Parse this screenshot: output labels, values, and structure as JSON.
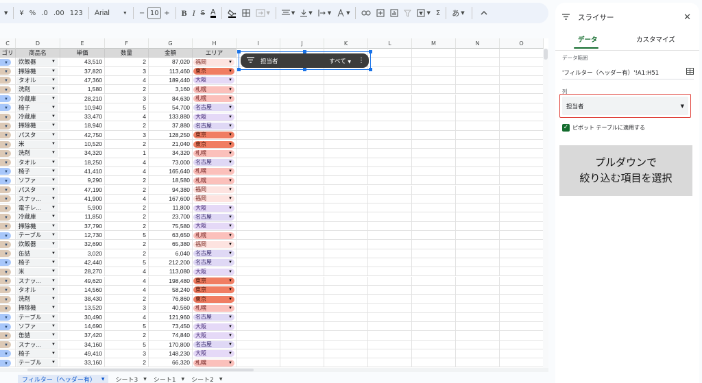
{
  "toolbar": {
    "font": "Arial",
    "font_size": "10",
    "percent": "%",
    "dec_dec": ".0",
    "dec_inc": ".00",
    "num_format": "123",
    "currency": "¥",
    "minus": "−",
    "plus": "+",
    "bold": "B",
    "italic": "I",
    "strike": "S",
    "text_color": "A",
    "sum": "Σ",
    "input_tools": "あ"
  },
  "columns": [
    "C",
    "D",
    "E",
    "F",
    "G",
    "H",
    "I",
    "J",
    "K",
    "L",
    "M",
    "N",
    "O"
  ],
  "header_row": {
    "c": "ゴリ",
    "d": "商品名",
    "e": "単価",
    "f": "数量",
    "g": "金額",
    "h": "エリア"
  },
  "rows": [
    {
      "c": "b",
      "d": "炊飯器",
      "e": "43,510",
      "f": "2",
      "g": "87,020",
      "h": "福岡"
    },
    {
      "c": "t",
      "d": "掃除機",
      "e": "37,820",
      "f": "3",
      "g": "113,460",
      "h": "東京"
    },
    {
      "c": "t",
      "d": "タオル",
      "e": "47,360",
      "f": "4",
      "g": "189,440",
      "h": "大阪"
    },
    {
      "c": "t",
      "d": "洗剤",
      "e": "1,580",
      "f": "2",
      "g": "3,160",
      "h": "札幌"
    },
    {
      "c": "b",
      "d": "冷蔵庫",
      "e": "28,210",
      "f": "3",
      "g": "84,630",
      "h": "札幌"
    },
    {
      "c": "b",
      "d": "椅子",
      "e": "10,940",
      "f": "5",
      "g": "54,700",
      "h": "名古屋"
    },
    {
      "c": "t",
      "d": "冷蔵庫",
      "e": "33,470",
      "f": "4",
      "g": "133,880",
      "h": "大阪"
    },
    {
      "c": "t",
      "d": "掃除機",
      "e": "18,940",
      "f": "2",
      "g": "37,880",
      "h": "名古屋"
    },
    {
      "c": "t",
      "d": "パスタ",
      "e": "42,750",
      "f": "3",
      "g": "128,250",
      "h": "東京"
    },
    {
      "c": "t",
      "d": "米",
      "e": "10,520",
      "f": "2",
      "g": "21,040",
      "h": "東京"
    },
    {
      "c": "t",
      "d": "洗剤",
      "e": "34,320",
      "f": "1",
      "g": "34,320",
      "h": "札幌"
    },
    {
      "c": "t",
      "d": "タオル",
      "e": "18,250",
      "f": "4",
      "g": "73,000",
      "h": "名古屋"
    },
    {
      "c": "b",
      "d": "椅子",
      "e": "41,410",
      "f": "4",
      "g": "165,640",
      "h": "札幌"
    },
    {
      "c": "b",
      "d": "ソファ",
      "e": "9,290",
      "f": "2",
      "g": "18,580",
      "h": "札幌"
    },
    {
      "c": "t",
      "d": "パスタ",
      "e": "47,190",
      "f": "2",
      "g": "94,380",
      "h": "福岡"
    },
    {
      "c": "t",
      "d": "スナッ...",
      "e": "41,900",
      "f": "4",
      "g": "167,600",
      "h": "福岡"
    },
    {
      "c": "t",
      "d": "電子レ...",
      "e": "5,900",
      "f": "2",
      "g": "11,800",
      "h": "大阪"
    },
    {
      "c": "t",
      "d": "冷蔵庫",
      "e": "11,850",
      "f": "2",
      "g": "23,700",
      "h": "名古屋"
    },
    {
      "c": "t",
      "d": "掃除機",
      "e": "37,790",
      "f": "2",
      "g": "75,580",
      "h": "大阪"
    },
    {
      "c": "b",
      "d": "テーブル",
      "e": "12,730",
      "f": "5",
      "g": "63,650",
      "h": "札幌"
    },
    {
      "c": "t",
      "d": "炊飯器",
      "e": "32,690",
      "f": "2",
      "g": "65,380",
      "h": "福岡"
    },
    {
      "c": "t",
      "d": "缶詰",
      "e": "3,020",
      "f": "2",
      "g": "6,040",
      "h": "名古屋"
    },
    {
      "c": "b",
      "d": "椅子",
      "e": "42,440",
      "f": "5",
      "g": "212,200",
      "h": "名古屋"
    },
    {
      "c": "t",
      "d": "米",
      "e": "28,270",
      "f": "4",
      "g": "113,080",
      "h": "大阪"
    },
    {
      "c": "t",
      "d": "スナッ...",
      "e": "49,620",
      "f": "4",
      "g": "198,480",
      "h": "東京"
    },
    {
      "c": "t",
      "d": "タオル",
      "e": "14,560",
      "f": "4",
      "g": "58,240",
      "h": "東京"
    },
    {
      "c": "t",
      "d": "洗剤",
      "e": "38,430",
      "f": "2",
      "g": "76,860",
      "h": "東京"
    },
    {
      "c": "t",
      "d": "掃除機",
      "e": "13,520",
      "f": "3",
      "g": "40,560",
      "h": "札幌"
    },
    {
      "c": "b",
      "d": "テーブル",
      "e": "30,490",
      "f": "4",
      "g": "121,960",
      "h": "名古屋"
    },
    {
      "c": "b",
      "d": "ソファ",
      "e": "14,690",
      "f": "5",
      "g": "73,450",
      "h": "大阪"
    },
    {
      "c": "t",
      "d": "缶詰",
      "e": "37,420",
      "f": "2",
      "g": "74,840",
      "h": "大阪"
    },
    {
      "c": "t",
      "d": "スナッ...",
      "e": "34,160",
      "f": "5",
      "g": "170,800",
      "h": "名古屋"
    },
    {
      "c": "b",
      "d": "椅子",
      "e": "49,410",
      "f": "3",
      "g": "148,230",
      "h": "大阪"
    },
    {
      "c": "b",
      "d": "テーブル",
      "e": "33,160",
      "f": "2",
      "g": "66,320",
      "h": "札幌"
    }
  ],
  "area_colors": {
    "福岡": {
      "bg": "#fde3e0",
      "fg": "#7a2a22"
    },
    "東京": {
      "bg": "#f07d62",
      "fg": "#4a1508"
    },
    "大阪": {
      "bg": "#e5d9f7",
      "fg": "#432a75"
    },
    "札幌": {
      "bg": "#fbc0bb",
      "fg": "#6e2020"
    },
    "名古屋": {
      "bg": "#dfd8f5",
      "fg": "#3a2e6e"
    }
  },
  "cat_colors": {
    "b": "#a8c7fa",
    "t": "#dcc9b6"
  },
  "slicer": {
    "name": "担当者",
    "value": "すべて"
  },
  "sheets": [
    {
      "name": "フィルター（ヘッダー有）",
      "active": true
    },
    {
      "name": "シート3",
      "active": false
    },
    {
      "name": "シート1",
      "active": false
    },
    {
      "name": "シート2",
      "active": false
    }
  ],
  "panel": {
    "title": "スライサー",
    "tab_data": "データ",
    "tab_custom": "カスタマイズ",
    "range_label": "データ範囲",
    "range_value": "'フィルター（ヘッダー有）'!A1:H51",
    "column_label": "列",
    "column_value": "担当者",
    "pivot_label": "ピボット テーブルに適用する",
    "note_line1": "プルダウンで",
    "note_line2": "絞り込む項目を選択"
  }
}
